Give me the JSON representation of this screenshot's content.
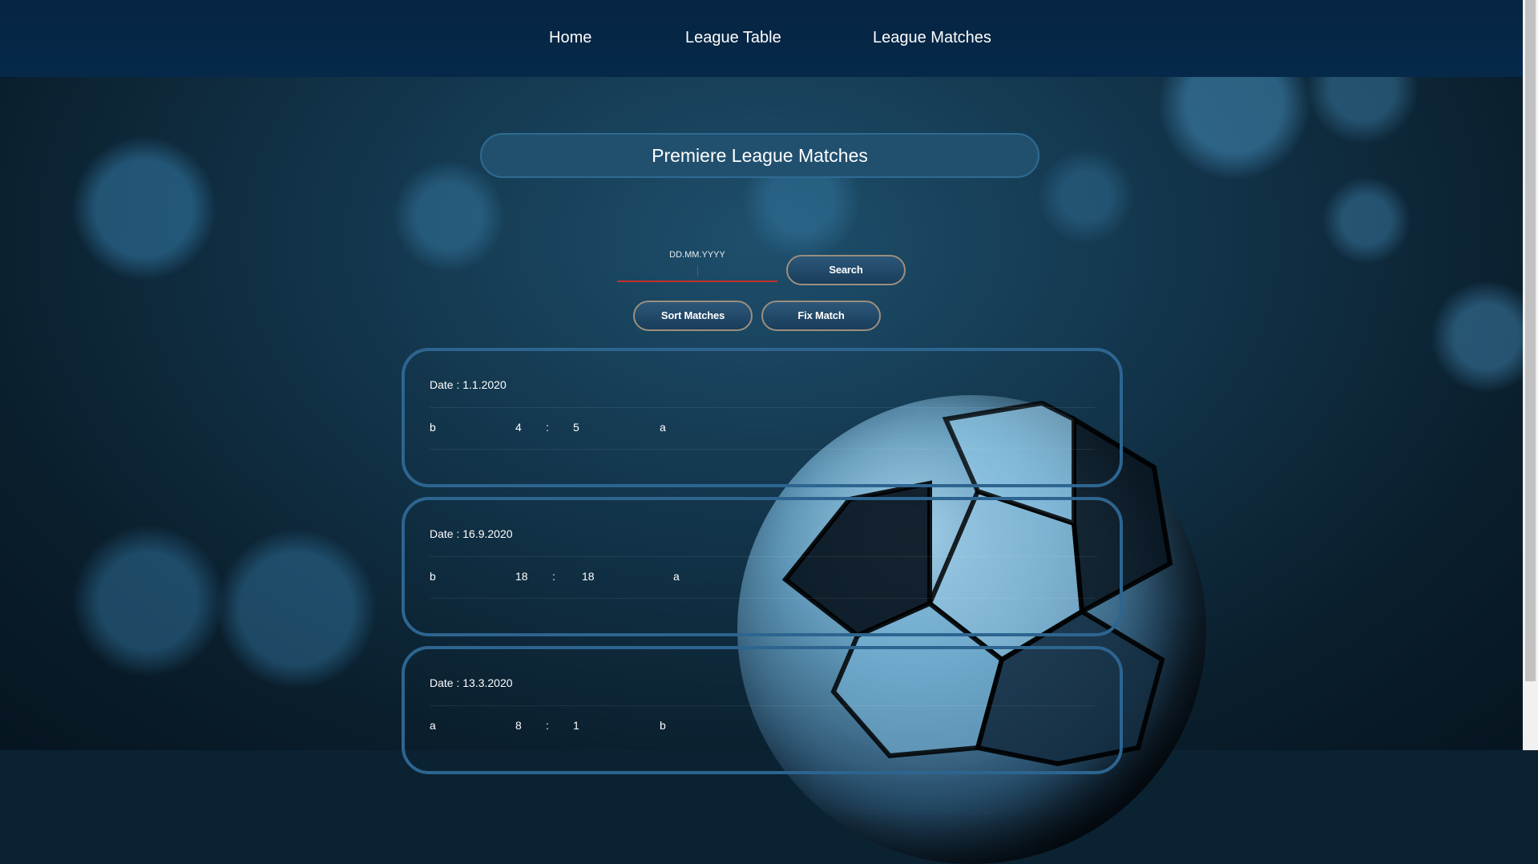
{
  "nav": {
    "home": "Home",
    "league_table": "League Table",
    "league_matches": "League Matches"
  },
  "page_title": "Premiere League Matches",
  "search": {
    "date_label": "DD.MM.YYYY",
    "value": "",
    "search_label": "Search"
  },
  "actions": {
    "sort_label": "Sort Matches",
    "fix_label": "Fix Match"
  },
  "matches": [
    {
      "date": "Date : 1.1.2020",
      "home": "b",
      "home_score": "4",
      "sep": ":",
      "away_score": "5",
      "away": "a"
    },
    {
      "date": "Date : 16.9.2020",
      "home": "b",
      "home_score": "18",
      "sep": ":",
      "away_score": "18",
      "away": "a"
    },
    {
      "date": "Date : 13.3.2020",
      "home": "a",
      "home_score": "8",
      "sep": ":",
      "away_score": "1",
      "away": "b"
    }
  ],
  "colors": {
    "nav_bg": "#052441",
    "card_border": "#2d6590",
    "input_underline": "#c0322b",
    "button_border": "#9b8f7e"
  }
}
